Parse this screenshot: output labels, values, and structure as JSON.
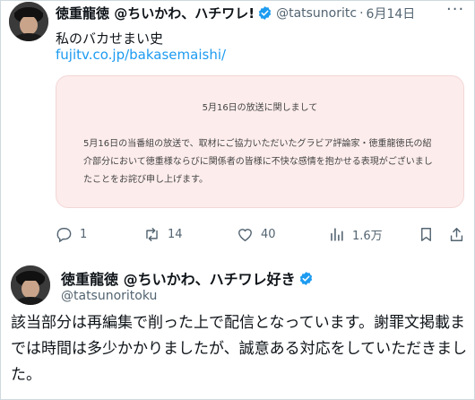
{
  "tweet1": {
    "author_name": "徳重龍徳 @ちいかわ、ハチワレ!",
    "handle": "@tatsunoritc",
    "separator": "·",
    "date": "6月14日",
    "more_label": "···",
    "text": "私のバカせまい史",
    "link": "fujitv.co.jp/bakasemaishi/",
    "card": {
      "title": "5月16日の放送に関しまして",
      "body": "5月16日の当番組の放送で、取材にご協力いただいたグラビア評論家・徳重龍徳氏の紹介部分において徳重様ならびに関係者の皆様に不快な感情を抱かせる表現がございましたことをお詫び申し上げます。"
    },
    "actions": {
      "replies": "1",
      "retweets": "14",
      "likes": "40",
      "views": "1.6万"
    }
  },
  "tweet2": {
    "author_name": "徳重龍徳 @ちいかわ、ハチワレ好き",
    "handle": "@tatsunoritoku",
    "text": "該当部分は再編集で削った上で配信となっています。謝罪文掲載までは時間は多少かかりましたが、誠意ある対応をしていただきました。"
  },
  "colors": {
    "verified": "#1d9bf0",
    "link": "#1d9bf0",
    "card_bg": "#fdecec",
    "muted": "#536471"
  },
  "icons": [
    "reply-icon",
    "retweet-icon",
    "like-icon",
    "views-icon",
    "bookmark-icon",
    "share-icon",
    "verified-badge-icon"
  ]
}
